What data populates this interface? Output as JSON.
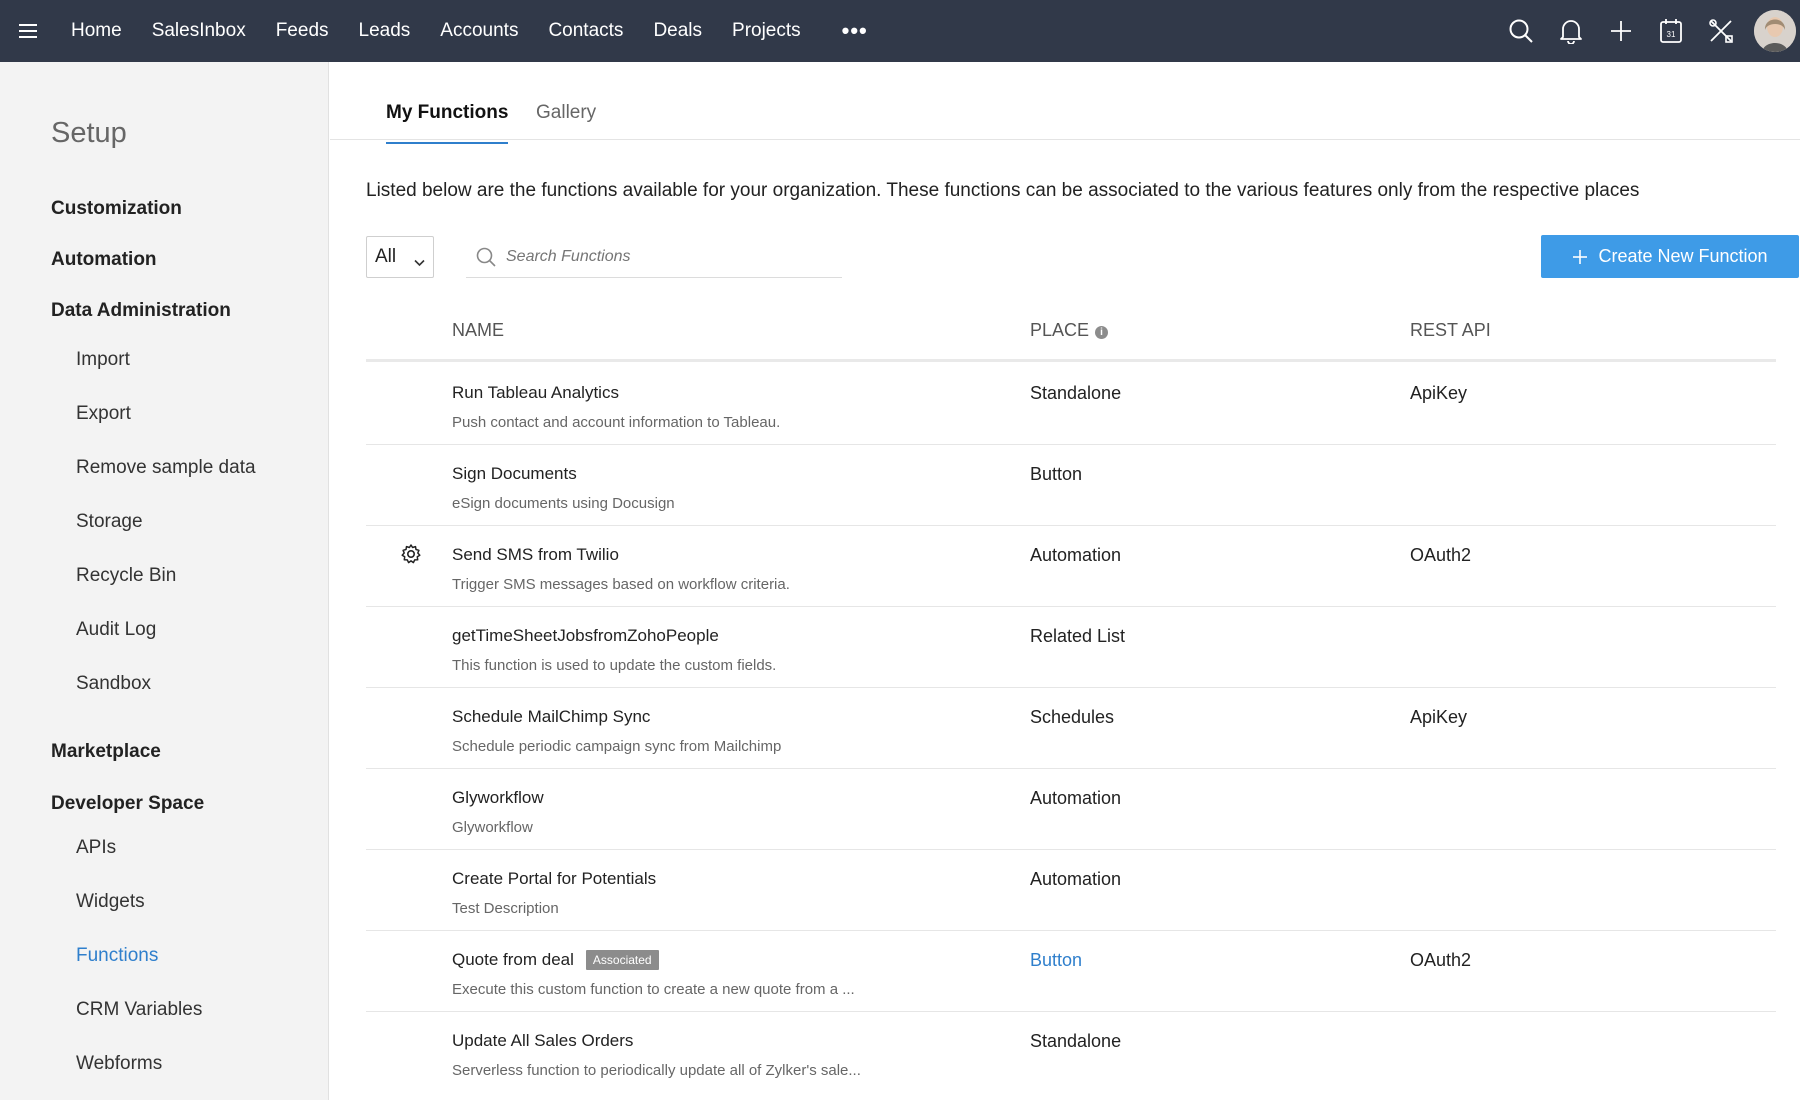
{
  "topnav": {
    "items": [
      "Home",
      "SalesInbox",
      "Feeds",
      "Leads",
      "Accounts",
      "Contacts",
      "Deals",
      "Projects"
    ],
    "more_label": "•••",
    "icons": [
      "search-icon",
      "bell-icon",
      "plus-icon",
      "calendar-icon",
      "tools-icon",
      "avatar"
    ],
    "calendar_day": "31"
  },
  "sidebar": {
    "title": "Setup",
    "sections": {
      "customization": "Customization",
      "automation": "Automation",
      "data_admin": "Data Administration",
      "marketplace": "Marketplace",
      "developer_space": "Developer Space"
    },
    "data_admin_items": [
      "Import",
      "Export",
      "Remove sample data",
      "Storage",
      "Recycle Bin",
      "Audit Log",
      "Sandbox"
    ],
    "developer_items": [
      "APIs",
      "Widgets",
      "Functions",
      "CRM Variables",
      "Webforms"
    ],
    "active_item": "Functions"
  },
  "tabs": [
    "My Functions",
    "Gallery"
  ],
  "intro": "Listed below are the functions available for your organization. These functions can be associated to the various features only from the respective places",
  "filter": {
    "value": "All"
  },
  "search": {
    "placeholder": "Search Functions"
  },
  "create_button": "Create New Function",
  "columns": {
    "name": "NAME",
    "place": "PLACE",
    "rest_api": "REST API"
  },
  "functions": [
    {
      "name": "Run Tableau Analytics",
      "desc": "Push contact and account information to Tableau.",
      "place": "Standalone",
      "api": "ApiKey"
    },
    {
      "name": "Sign Documents",
      "desc": "eSign documents using Docusign",
      "place": "Button",
      "api": ""
    },
    {
      "name": "Send SMS from Twilio",
      "desc": "Trigger SMS messages based on workflow criteria.",
      "place": "Automation",
      "api": "OAuth2"
    },
    {
      "name": "getTimeSheetJobsfromZohoPeople",
      "desc": "This function is used to update the custom fields.",
      "place": "Related List",
      "api": ""
    },
    {
      "name": "Schedule MailChimp Sync",
      "desc": "Schedule periodic campaign sync from Mailchimp",
      "place": "Schedules",
      "api": "ApiKey"
    },
    {
      "name": "Glyworkflow",
      "desc": "Glyworkflow",
      "place": "Automation",
      "api": ""
    },
    {
      "name": "Create Portal for Potentials",
      "desc": "Test Description",
      "place": "Automation",
      "api": ""
    },
    {
      "name": "Quote from deal",
      "badge": "Associated",
      "desc": "Execute this custom function to create a new quote from a ...",
      "place": "Button",
      "api": "OAuth2"
    },
    {
      "name": "Update All Sales Orders",
      "desc": "Serverless function to periodically update all of Zylker's sale...",
      "place": "Standalone",
      "api": ""
    }
  ],
  "colors": {
    "nav_bg": "#313949",
    "accent": "#2f7fcc",
    "button": "#3e9be7"
  }
}
